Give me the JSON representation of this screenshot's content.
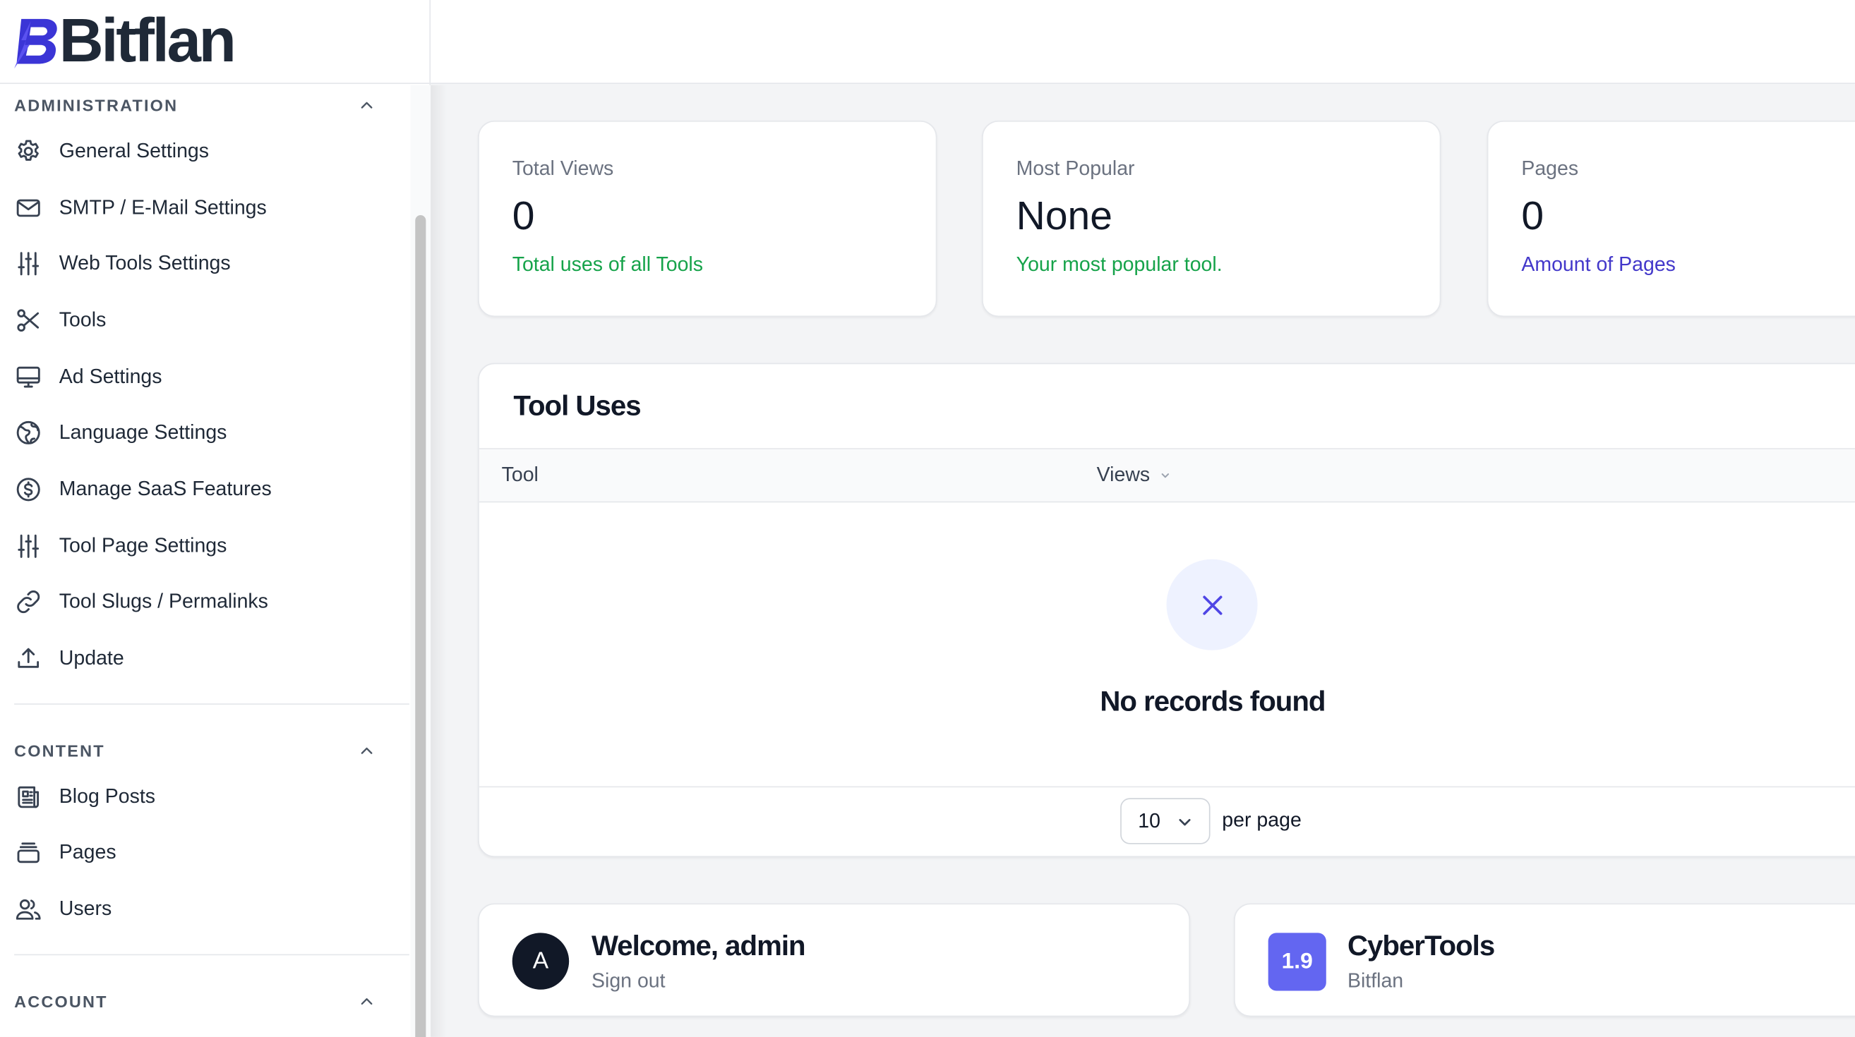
{
  "brand": {
    "name": "Bitflan",
    "accent": "#4f46e5"
  },
  "sidebar": {
    "groups": [
      {
        "title": "ADMINISTRATION",
        "items": [
          {
            "label": "General Settings",
            "icon": "gear-icon"
          },
          {
            "label": "SMTP / E-Mail Settings",
            "icon": "envelope-icon"
          },
          {
            "label": "Web Tools Settings",
            "icon": "sliders-icon"
          },
          {
            "label": "Tools",
            "icon": "scissors-icon"
          },
          {
            "label": "Ad Settings",
            "icon": "desktop-icon"
          },
          {
            "label": "Language Settings",
            "icon": "globe-icon"
          },
          {
            "label": "Manage SaaS Features",
            "icon": "dollar-circle-icon"
          },
          {
            "label": "Tool Page Settings",
            "icon": "sliders-icon"
          },
          {
            "label": "Tool Slugs / Permalinks",
            "icon": "link-icon"
          },
          {
            "label": "Update",
            "icon": "upload-icon"
          }
        ]
      },
      {
        "title": "CONTENT",
        "items": [
          {
            "label": "Blog Posts",
            "icon": "newspaper-icon"
          },
          {
            "label": "Pages",
            "icon": "stack-icon"
          },
          {
            "label": "Users",
            "icon": "users-icon"
          }
        ]
      },
      {
        "title": "ACCOUNT",
        "items": []
      }
    ]
  },
  "stats": [
    {
      "label": "Total Views",
      "value": "0",
      "description": "Total uses of all Tools",
      "color": "#16a34a"
    },
    {
      "label": "Most Popular",
      "value": "None",
      "description": "Your most popular tool.",
      "color": "#16a34a"
    },
    {
      "label": "Pages",
      "value": "0",
      "description": "Amount of Pages",
      "color": "#4338ca"
    }
  ],
  "tool_uses": {
    "title": "Tool Uses",
    "columns": [
      "Tool",
      "Views"
    ],
    "empty_message": "No records found",
    "per_page_value": "10",
    "per_page_label": "per page"
  },
  "welcome": {
    "title": "Welcome, admin",
    "subtitle": "Sign out",
    "avatar_initial": "A"
  },
  "version": {
    "badge": "1.9",
    "title": "CyberTools",
    "subtitle": "Bitflan",
    "badge_color": "#6366f1"
  }
}
